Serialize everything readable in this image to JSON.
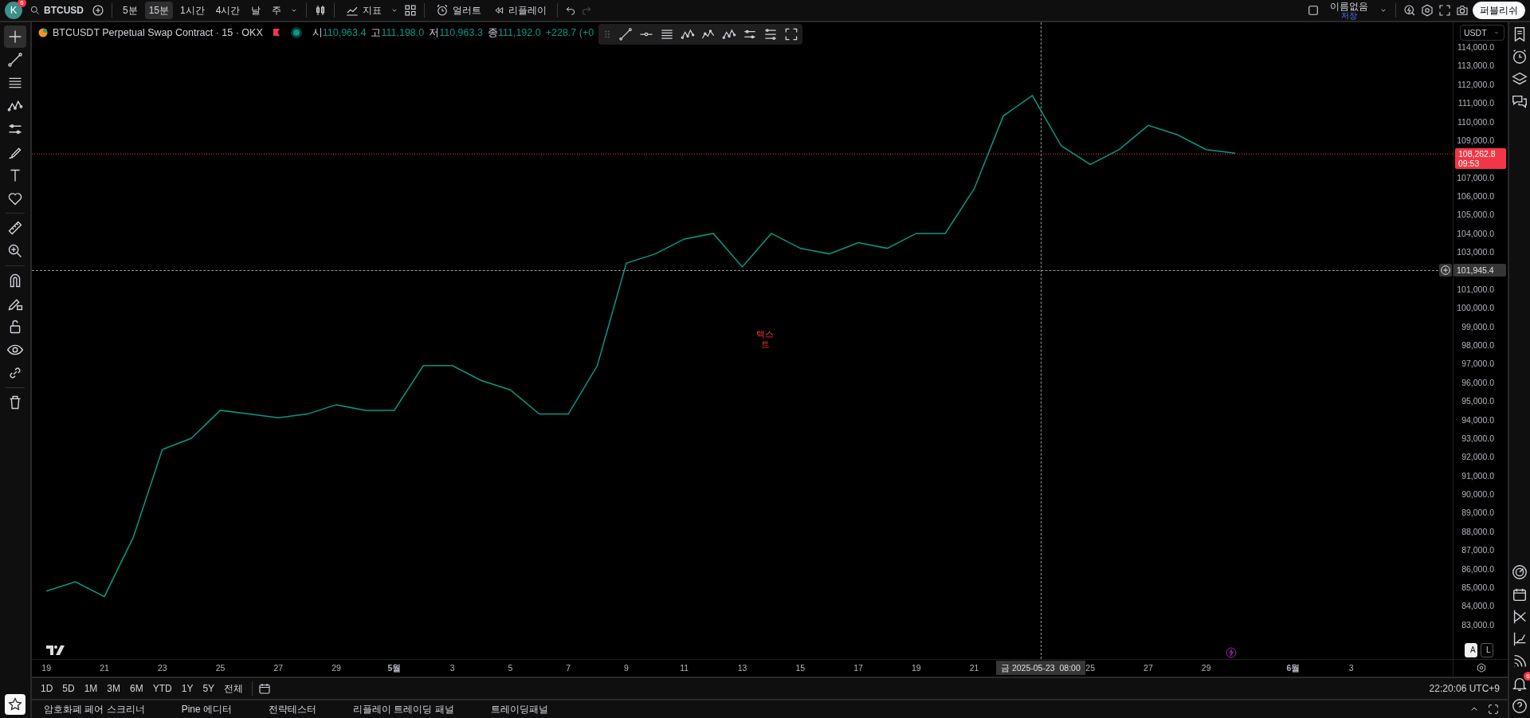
{
  "top_bar": {
    "avatar": {
      "letter": "K",
      "badge": "6"
    },
    "symbol": "BTCUSD",
    "intervals": [
      {
        "label": "5분",
        "selected": false
      },
      {
        "label": "15분",
        "selected": true
      },
      {
        "label": "1시간",
        "selected": false
      },
      {
        "label": "4시간",
        "selected": false
      },
      {
        "label": "날",
        "selected": false
      },
      {
        "label": "주",
        "selected": false
      }
    ],
    "indicators": "지표",
    "alerts": "얼러트",
    "replay": "리플레이",
    "redo_disabled": true,
    "layout": {
      "name": "이름없음",
      "status": "저장"
    },
    "publish": "퍼블리쉬"
  },
  "drawing_tools": [
    {
      "selected": true
    },
    {
      "selected": false
    },
    {
      "selected": false
    },
    {
      "selected": false
    },
    {
      "selected": false
    },
    {
      "selected": false
    },
    {
      "selected": false
    },
    {
      "selected": false
    },
    {
      "selected": false
    },
    {
      "selected": false
    },
    {
      "selected": false
    },
    {
      "selected": false
    },
    {
      "selected": false
    },
    {
      "selected": false
    },
    {
      "selected": false
    },
    {
      "selected": false
    }
  ],
  "legend": {
    "title": "BTCUSDT Perpetual Swap Contract · 15 · OKX",
    "values": [
      {
        "label": "시",
        "value": "110,963.4"
      },
      {
        "label": "고",
        "value": "111,198.0"
      },
      {
        "label": "저",
        "value": "110,963.3"
      },
      {
        "label": "종",
        "value": "111,192.0"
      }
    ],
    "change": "+228.7 (+0"
  },
  "currency": "USDT",
  "chart_data": {
    "type": "line",
    "categories": [
      "19",
      null,
      "21",
      null,
      "23",
      null,
      "25",
      null,
      "27",
      null,
      "29",
      null,
      "5월",
      null,
      "3",
      null,
      "5",
      null,
      "7",
      null,
      "9",
      null,
      "11",
      null,
      "13",
      null,
      "15",
      null,
      "17",
      null,
      "19",
      null,
      "21",
      null,
      null,
      null,
      "25",
      null,
      "27",
      null,
      "29",
      null,
      null,
      "6월",
      null,
      "3",
      null,
      null,
      null
    ],
    "series": [
      {
        "color": "#089981",
        "values": [
          84800,
          85300,
          84500,
          87700,
          92400,
          93000,
          94500,
          94300,
          94100,
          94300,
          94800,
          94500,
          94500,
          96900,
          96900,
          96100,
          95600,
          94300,
          94300,
          96900,
          102400,
          102900,
          103700,
          104000,
          102200,
          104000,
          103200,
          102900,
          103500,
          103200,
          104000,
          104000,
          106400,
          110300,
          111400,
          108700,
          107700,
          108500,
          109800,
          109300,
          108500,
          108300,
          null,
          null,
          null,
          null,
          null,
          null,
          null
        ]
      }
    ],
    "ylim": [
      81150,
      115330
    ],
    "yticks": [
      {
        "value": 114000,
        "label": "114,000.0"
      },
      {
        "value": 113000,
        "label": "113,000.0"
      },
      {
        "value": 112000,
        "label": "112,000.0"
      },
      {
        "value": 111000,
        "label": "111,000.0"
      },
      {
        "value": 110000,
        "label": "110,000.0"
      },
      {
        "value": 109000,
        "label": "109,000.0"
      },
      {
        "value": 107000,
        "label": "107,000.0"
      },
      {
        "value": 106000,
        "label": "106,000.0"
      },
      {
        "value": 105000,
        "label": "105,000.0"
      },
      {
        "value": 104000,
        "label": "104,000.0"
      },
      {
        "value": 103000,
        "label": "103,000.0"
      },
      {
        "value": 101000,
        "label": "101,000.0"
      },
      {
        "value": 100000,
        "label": "100,000.0"
      },
      {
        "value": 99000,
        "label": "99,000.0"
      },
      {
        "value": 98000,
        "label": "98,000.0"
      },
      {
        "value": 97000,
        "label": "97,000.0"
      },
      {
        "value": 96000,
        "label": "96,000.0"
      },
      {
        "value": 95000,
        "label": "95,000.0"
      },
      {
        "value": 94000,
        "label": "94,000.0"
      },
      {
        "value": 93000,
        "label": "93,000.0"
      },
      {
        "value": 92000,
        "label": "92,000.0"
      },
      {
        "value": 91000,
        "label": "91,000.0"
      },
      {
        "value": 90000,
        "label": "90,000.0"
      },
      {
        "value": 89000,
        "label": "89,000.0"
      },
      {
        "value": 88000,
        "label": "88,000.0"
      },
      {
        "value": 87000,
        "label": "87,000.0"
      },
      {
        "value": 86000,
        "label": "86,000.0"
      },
      {
        "value": 85000,
        "label": "85,000.0"
      },
      {
        "value": 84000,
        "label": "84,000.0"
      },
      {
        "value": 83000,
        "label": "83,000.0"
      }
    ],
    "ref_lines": [
      {
        "axis": "y",
        "value": 108262.8,
        "label": "108,262.8",
        "color": "#f23645"
      }
    ]
  },
  "price_countdown": "09:53",
  "crosshair": {
    "price": "101,945.4",
    "time": "금 2025-05-23  08:00"
  },
  "chart_note": "텍스트",
  "scale_buttons": [
    {
      "label": "A",
      "selected": true
    },
    {
      "label": "L",
      "selected": false
    }
  ],
  "periods": [
    "1D",
    "5D",
    "1M",
    "3M",
    "6M",
    "YTD",
    "1Y",
    "5Y",
    "전체"
  ],
  "clock": "22:20:06 UTC+9",
  "bottom_tabs": [
    "암호화폐 페어 스크리너",
    "Pine 에디터",
    "전략테스터",
    "리플레이 트레이딩 패널",
    "트레이딩패널"
  ],
  "right_sidebar": {
    "alert_badge": "6"
  }
}
